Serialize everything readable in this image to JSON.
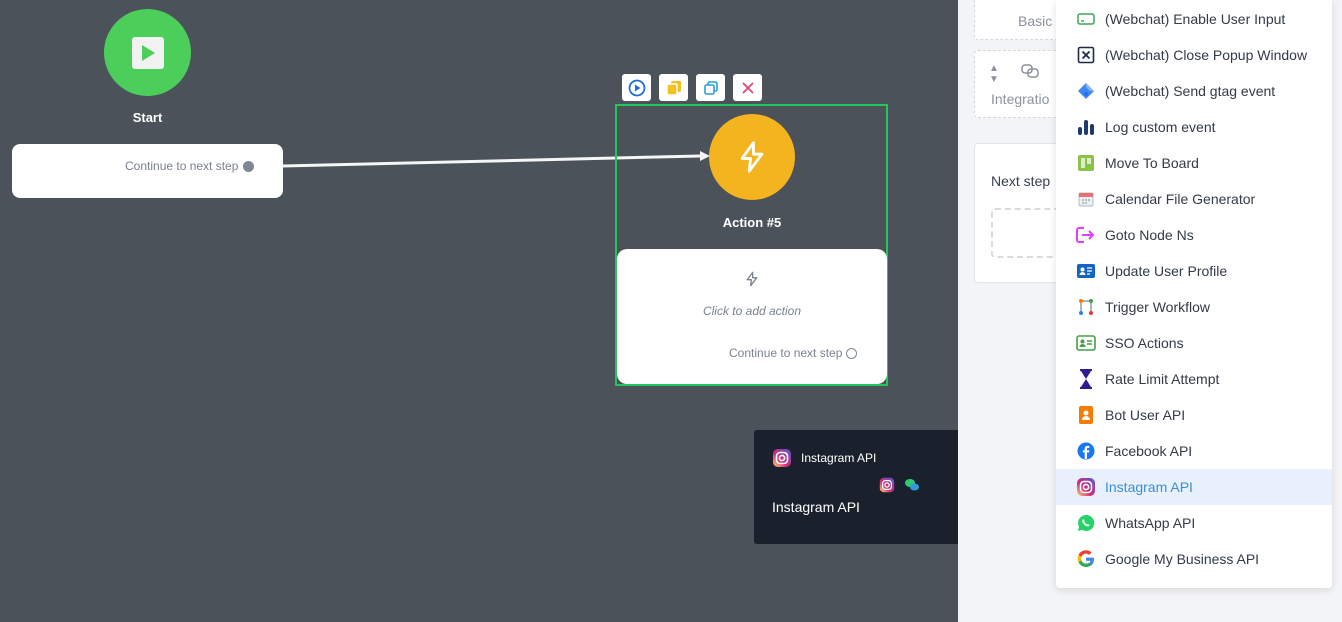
{
  "canvas": {
    "start": {
      "title": "Start",
      "next_step": "Continue to next step"
    },
    "action": {
      "title": "Action #5",
      "add_action": "Click to add action",
      "next_step": "Continue to next step"
    },
    "toolbar": [
      "play-icon",
      "copy-icon",
      "duplicate-icon",
      "close-icon"
    ],
    "tooltip": {
      "header": "Instagram API",
      "name": "Instagram API"
    }
  },
  "panel": {
    "basic_label": "Basic",
    "integration_label": "Integratio",
    "next_step_label": "Next step"
  },
  "menu": {
    "items": [
      {
        "label": "(Webchat) Enable User Input",
        "icon": "input-icon",
        "color": "#3aa757"
      },
      {
        "label": "(Webchat) Close Popup Window",
        "icon": "close-window-icon",
        "color": "#1f2a44"
      },
      {
        "label": "(Webchat) Send gtag event",
        "icon": "gtag-icon",
        "color": "#4285f4"
      },
      {
        "label": "Log custom event",
        "icon": "bar-chart-icon",
        "color": "#1f3b6b"
      },
      {
        "label": "Move To Board",
        "icon": "board-icon",
        "color": "#8bc34a"
      },
      {
        "label": "Calendar File Generator",
        "icon": "calendar-icon",
        "color": "#e57373"
      },
      {
        "label": "Goto Node Ns",
        "icon": "goto-icon",
        "color": "#e040fb"
      },
      {
        "label": "Update User Profile",
        "icon": "profile-card-icon",
        "color": "#1565c0"
      },
      {
        "label": "Trigger Workflow",
        "icon": "workflow-icon",
        "color": "#f57c00"
      },
      {
        "label": "SSO Actions",
        "icon": "id-card-icon",
        "color": "#43a047"
      },
      {
        "label": "Rate Limit Attempt",
        "icon": "hourglass-icon",
        "color": "#311b92"
      },
      {
        "label": "Bot User API",
        "icon": "badge-icon",
        "color": "#f57c00"
      },
      {
        "label": "Facebook API",
        "icon": "facebook-icon",
        "color": "#1877f2"
      },
      {
        "label": "Instagram API",
        "icon": "instagram-icon",
        "color": "#d62976"
      },
      {
        "label": "WhatsApp API",
        "icon": "whatsapp-icon",
        "color": "#25d366"
      },
      {
        "label": "Google My Business API",
        "icon": "google-icon",
        "color": "#4285f4"
      }
    ],
    "highlighted": "Instagram API"
  },
  "colors": {
    "start": "#4ccf5a",
    "action": "#f4b41f",
    "selection": "#22c55e",
    "canvas": "#4b525a"
  }
}
